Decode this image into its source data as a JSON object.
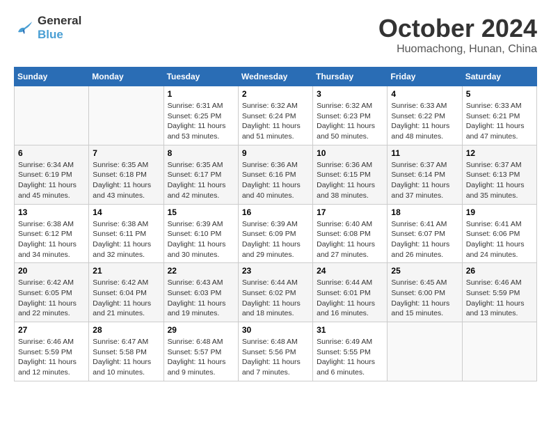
{
  "header": {
    "logo_line1": "General",
    "logo_line2": "Blue",
    "month": "October 2024",
    "location": "Huomachong, Hunan, China"
  },
  "days_of_week": [
    "Sunday",
    "Monday",
    "Tuesday",
    "Wednesday",
    "Thursday",
    "Friday",
    "Saturday"
  ],
  "weeks": [
    [
      {
        "day": "",
        "sunrise": "",
        "sunset": "",
        "daylight": ""
      },
      {
        "day": "",
        "sunrise": "",
        "sunset": "",
        "daylight": ""
      },
      {
        "day": "1",
        "sunrise": "Sunrise: 6:31 AM",
        "sunset": "Sunset: 6:25 PM",
        "daylight": "Daylight: 11 hours and 53 minutes."
      },
      {
        "day": "2",
        "sunrise": "Sunrise: 6:32 AM",
        "sunset": "Sunset: 6:24 PM",
        "daylight": "Daylight: 11 hours and 51 minutes."
      },
      {
        "day": "3",
        "sunrise": "Sunrise: 6:32 AM",
        "sunset": "Sunset: 6:23 PM",
        "daylight": "Daylight: 11 hours and 50 minutes."
      },
      {
        "day": "4",
        "sunrise": "Sunrise: 6:33 AM",
        "sunset": "Sunset: 6:22 PM",
        "daylight": "Daylight: 11 hours and 48 minutes."
      },
      {
        "day": "5",
        "sunrise": "Sunrise: 6:33 AM",
        "sunset": "Sunset: 6:21 PM",
        "daylight": "Daylight: 11 hours and 47 minutes."
      }
    ],
    [
      {
        "day": "6",
        "sunrise": "Sunrise: 6:34 AM",
        "sunset": "Sunset: 6:19 PM",
        "daylight": "Daylight: 11 hours and 45 minutes."
      },
      {
        "day": "7",
        "sunrise": "Sunrise: 6:35 AM",
        "sunset": "Sunset: 6:18 PM",
        "daylight": "Daylight: 11 hours and 43 minutes."
      },
      {
        "day": "8",
        "sunrise": "Sunrise: 6:35 AM",
        "sunset": "Sunset: 6:17 PM",
        "daylight": "Daylight: 11 hours and 42 minutes."
      },
      {
        "day": "9",
        "sunrise": "Sunrise: 6:36 AM",
        "sunset": "Sunset: 6:16 PM",
        "daylight": "Daylight: 11 hours and 40 minutes."
      },
      {
        "day": "10",
        "sunrise": "Sunrise: 6:36 AM",
        "sunset": "Sunset: 6:15 PM",
        "daylight": "Daylight: 11 hours and 38 minutes."
      },
      {
        "day": "11",
        "sunrise": "Sunrise: 6:37 AM",
        "sunset": "Sunset: 6:14 PM",
        "daylight": "Daylight: 11 hours and 37 minutes."
      },
      {
        "day": "12",
        "sunrise": "Sunrise: 6:37 AM",
        "sunset": "Sunset: 6:13 PM",
        "daylight": "Daylight: 11 hours and 35 minutes."
      }
    ],
    [
      {
        "day": "13",
        "sunrise": "Sunrise: 6:38 AM",
        "sunset": "Sunset: 6:12 PM",
        "daylight": "Daylight: 11 hours and 34 minutes."
      },
      {
        "day": "14",
        "sunrise": "Sunrise: 6:38 AM",
        "sunset": "Sunset: 6:11 PM",
        "daylight": "Daylight: 11 hours and 32 minutes."
      },
      {
        "day": "15",
        "sunrise": "Sunrise: 6:39 AM",
        "sunset": "Sunset: 6:10 PM",
        "daylight": "Daylight: 11 hours and 30 minutes."
      },
      {
        "day": "16",
        "sunrise": "Sunrise: 6:39 AM",
        "sunset": "Sunset: 6:09 PM",
        "daylight": "Daylight: 11 hours and 29 minutes."
      },
      {
        "day": "17",
        "sunrise": "Sunrise: 6:40 AM",
        "sunset": "Sunset: 6:08 PM",
        "daylight": "Daylight: 11 hours and 27 minutes."
      },
      {
        "day": "18",
        "sunrise": "Sunrise: 6:41 AM",
        "sunset": "Sunset: 6:07 PM",
        "daylight": "Daylight: 11 hours and 26 minutes."
      },
      {
        "day": "19",
        "sunrise": "Sunrise: 6:41 AM",
        "sunset": "Sunset: 6:06 PM",
        "daylight": "Daylight: 11 hours and 24 minutes."
      }
    ],
    [
      {
        "day": "20",
        "sunrise": "Sunrise: 6:42 AM",
        "sunset": "Sunset: 6:05 PM",
        "daylight": "Daylight: 11 hours and 22 minutes."
      },
      {
        "day": "21",
        "sunrise": "Sunrise: 6:42 AM",
        "sunset": "Sunset: 6:04 PM",
        "daylight": "Daylight: 11 hours and 21 minutes."
      },
      {
        "day": "22",
        "sunrise": "Sunrise: 6:43 AM",
        "sunset": "Sunset: 6:03 PM",
        "daylight": "Daylight: 11 hours and 19 minutes."
      },
      {
        "day": "23",
        "sunrise": "Sunrise: 6:44 AM",
        "sunset": "Sunset: 6:02 PM",
        "daylight": "Daylight: 11 hours and 18 minutes."
      },
      {
        "day": "24",
        "sunrise": "Sunrise: 6:44 AM",
        "sunset": "Sunset: 6:01 PM",
        "daylight": "Daylight: 11 hours and 16 minutes."
      },
      {
        "day": "25",
        "sunrise": "Sunrise: 6:45 AM",
        "sunset": "Sunset: 6:00 PM",
        "daylight": "Daylight: 11 hours and 15 minutes."
      },
      {
        "day": "26",
        "sunrise": "Sunrise: 6:46 AM",
        "sunset": "Sunset: 5:59 PM",
        "daylight": "Daylight: 11 hours and 13 minutes."
      }
    ],
    [
      {
        "day": "27",
        "sunrise": "Sunrise: 6:46 AM",
        "sunset": "Sunset: 5:59 PM",
        "daylight": "Daylight: 11 hours and 12 minutes."
      },
      {
        "day": "28",
        "sunrise": "Sunrise: 6:47 AM",
        "sunset": "Sunset: 5:58 PM",
        "daylight": "Daylight: 11 hours and 10 minutes."
      },
      {
        "day": "29",
        "sunrise": "Sunrise: 6:48 AM",
        "sunset": "Sunset: 5:57 PM",
        "daylight": "Daylight: 11 hours and 9 minutes."
      },
      {
        "day": "30",
        "sunrise": "Sunrise: 6:48 AM",
        "sunset": "Sunset: 5:56 PM",
        "daylight": "Daylight: 11 hours and 7 minutes."
      },
      {
        "day": "31",
        "sunrise": "Sunrise: 6:49 AM",
        "sunset": "Sunset: 5:55 PM",
        "daylight": "Daylight: 11 hours and 6 minutes."
      },
      {
        "day": "",
        "sunrise": "",
        "sunset": "",
        "daylight": ""
      },
      {
        "day": "",
        "sunrise": "",
        "sunset": "",
        "daylight": ""
      }
    ]
  ]
}
